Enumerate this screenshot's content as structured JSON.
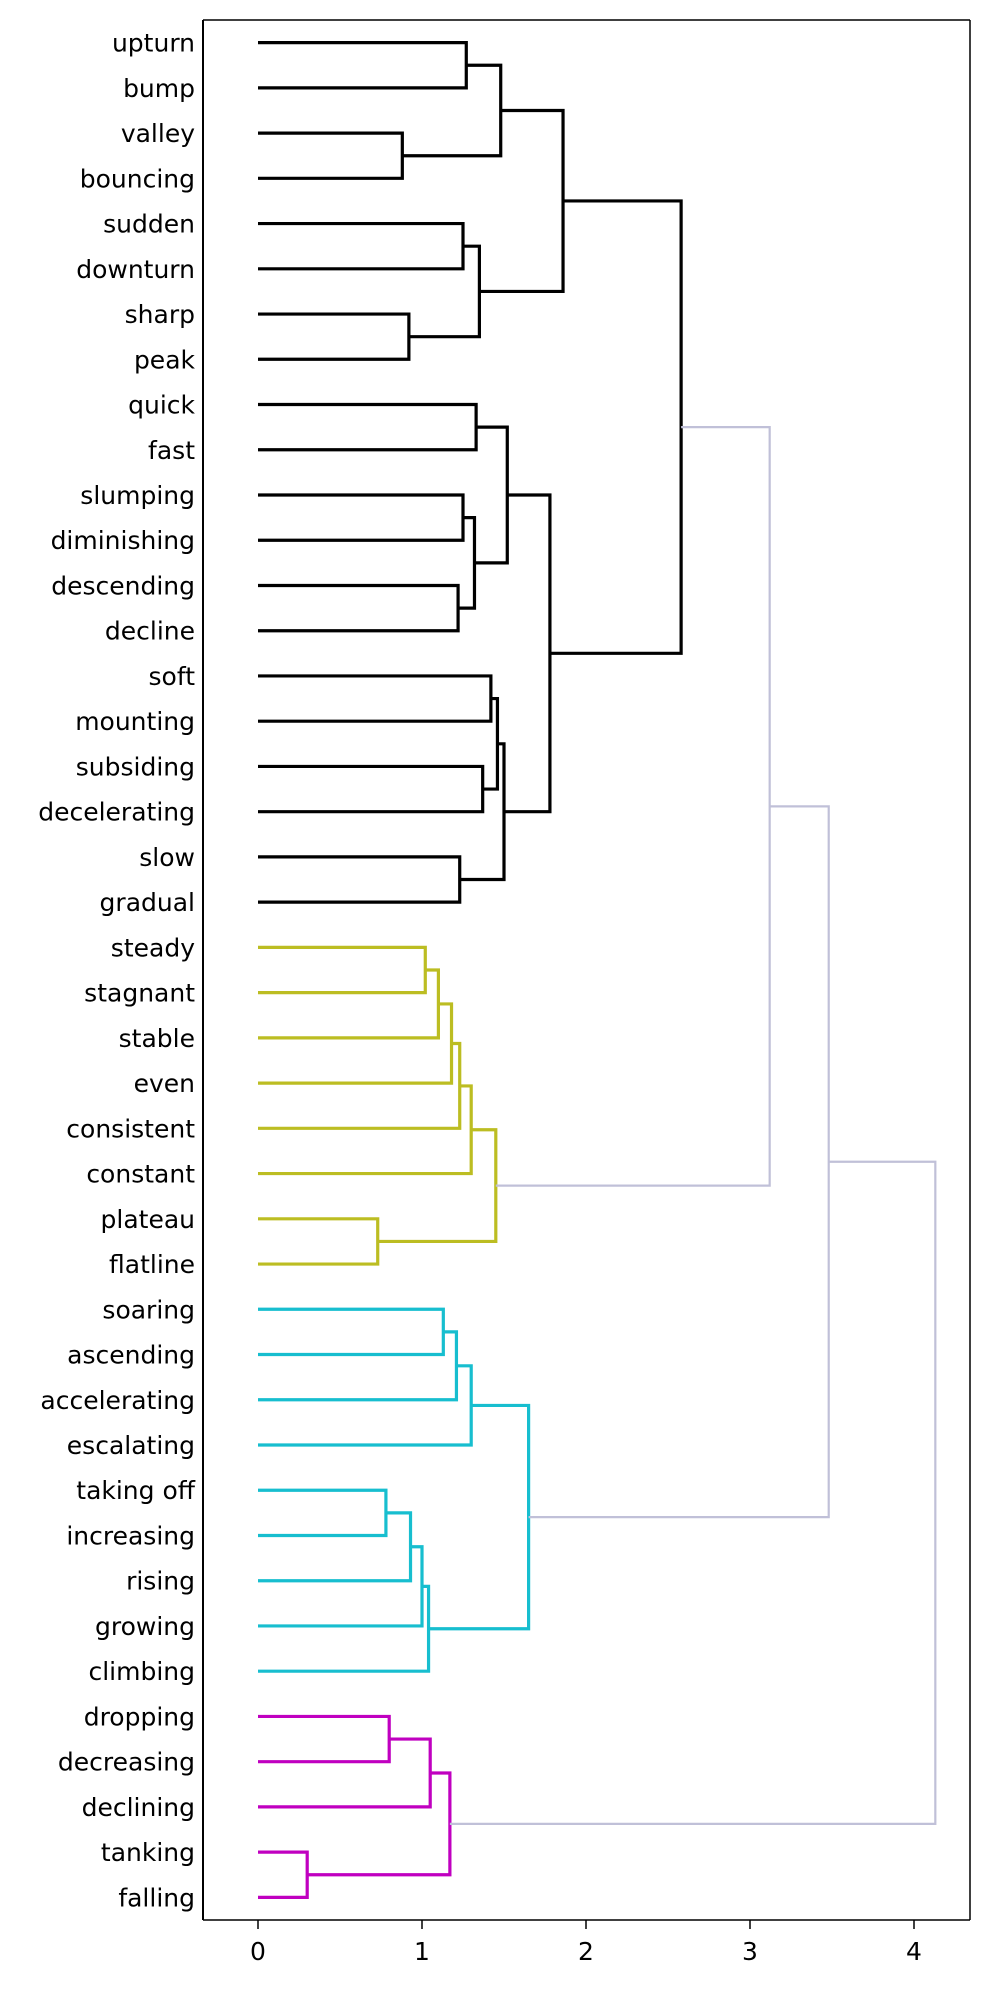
{
  "chart_data": {
    "type": "dendrogram",
    "title": "",
    "xlabel": "",
    "ylabel": "",
    "orientation": "left",
    "xlim": [
      -0.335,
      4.36
    ],
    "xticks": [
      0,
      1,
      2,
      3,
      4
    ],
    "xtick_labels": [
      "0",
      "1",
      "2",
      "3",
      "4"
    ],
    "grid": false,
    "legend": null,
    "leaf_labels": [
      "upturn",
      "bump",
      "valley",
      "bouncing",
      "sudden",
      "downturn",
      "sharp",
      "peak",
      "quick",
      "fast",
      "slumping",
      "diminishing",
      "descending",
      "decline",
      "soft",
      "mounting",
      "subsiding",
      "decelerating",
      "slow",
      "gradual",
      "steady",
      "stagnant",
      "stable",
      "even",
      "consistent",
      "constant",
      "plateau",
      "flatline",
      "soaring",
      "ascending",
      "accelerating",
      "escalating",
      "taking off",
      "increasing",
      "rising",
      "growing",
      "climbing",
      "dropping",
      "decreasing",
      "declining",
      "tanking",
      "falling"
    ],
    "cluster_colors": {
      "black": "#000000",
      "olive": "#bcbd22",
      "cyan": "#17becf",
      "magenta": "#c000c0",
      "above_threshold": "#c0c0d8"
    },
    "leaf_cluster_color": [
      "black",
      "black",
      "black",
      "black",
      "black",
      "black",
      "black",
      "black",
      "black",
      "black",
      "black",
      "black",
      "black",
      "black",
      "black",
      "black",
      "black",
      "black",
      "black",
      "black",
      "olive",
      "olive",
      "olive",
      "olive",
      "olive",
      "olive",
      "olive",
      "olive",
      "cyan",
      "cyan",
      "cyan",
      "cyan",
      "cyan",
      "cyan",
      "cyan",
      "cyan",
      "cyan",
      "magenta",
      "magenta",
      "magenta",
      "magenta"
    ],
    "links": [
      {
        "id": "L1",
        "left": {
          "type": "leaf",
          "i": 0
        },
        "right": {
          "type": "leaf",
          "i": 1
        },
        "height": 1.27,
        "color": "black"
      },
      {
        "id": "L2",
        "left": {
          "type": "leaf",
          "i": 2
        },
        "right": {
          "type": "leaf",
          "i": 3
        },
        "height": 0.88,
        "color": "black"
      },
      {
        "id": "L3",
        "left": {
          "type": "link",
          "i": "L1"
        },
        "right": {
          "type": "link",
          "i": "L2"
        },
        "height": 1.48,
        "color": "black"
      },
      {
        "id": "L4",
        "left": {
          "type": "leaf",
          "i": 4
        },
        "right": {
          "type": "leaf",
          "i": 5
        },
        "height": 1.25,
        "color": "black"
      },
      {
        "id": "L5",
        "left": {
          "type": "leaf",
          "i": 6
        },
        "right": {
          "type": "leaf",
          "i": 7
        },
        "height": 0.92,
        "color": "black"
      },
      {
        "id": "L6",
        "left": {
          "type": "link",
          "i": "L4"
        },
        "right": {
          "type": "link",
          "i": "L5"
        },
        "height": 1.35,
        "color": "black"
      },
      {
        "id": "L7",
        "left": {
          "type": "link",
          "i": "L3"
        },
        "right": {
          "type": "link",
          "i": "L6"
        },
        "height": 1.86,
        "color": "black"
      },
      {
        "id": "L8",
        "left": {
          "type": "leaf",
          "i": 8
        },
        "right": {
          "type": "leaf",
          "i": 9
        },
        "height": 1.33,
        "color": "black"
      },
      {
        "id": "L9",
        "left": {
          "type": "leaf",
          "i": 10
        },
        "right": {
          "type": "leaf",
          "i": 11
        },
        "height": 1.25,
        "color": "black"
      },
      {
        "id": "L10",
        "left": {
          "type": "leaf",
          "i": 12
        },
        "right": {
          "type": "leaf",
          "i": 13
        },
        "height": 1.22,
        "color": "black"
      },
      {
        "id": "L11",
        "left": {
          "type": "link",
          "i": "L9"
        },
        "right": {
          "type": "link",
          "i": "L10"
        },
        "height": 1.32,
        "color": "black"
      },
      {
        "id": "L12",
        "left": {
          "type": "link",
          "i": "L8"
        },
        "right": {
          "type": "link",
          "i": "L11"
        },
        "height": 1.52,
        "color": "black"
      },
      {
        "id": "L13",
        "left": {
          "type": "leaf",
          "i": 14
        },
        "right": {
          "type": "leaf",
          "i": 15
        },
        "height": 1.42,
        "color": "black"
      },
      {
        "id": "L14",
        "left": {
          "type": "leaf",
          "i": 16
        },
        "right": {
          "type": "leaf",
          "i": 17
        },
        "height": 1.37,
        "color": "black"
      },
      {
        "id": "L15",
        "left": {
          "type": "link",
          "i": "L13"
        },
        "right": {
          "type": "link",
          "i": "L14"
        },
        "height": 1.46,
        "color": "black"
      },
      {
        "id": "L16",
        "left": {
          "type": "leaf",
          "i": 18
        },
        "right": {
          "type": "leaf",
          "i": 19
        },
        "height": 1.23,
        "color": "black"
      },
      {
        "id": "L17",
        "left": {
          "type": "link",
          "i": "L15"
        },
        "right": {
          "type": "link",
          "i": "L16"
        },
        "height": 1.5,
        "color": "black"
      },
      {
        "id": "L18",
        "left": {
          "type": "link",
          "i": "L12"
        },
        "right": {
          "type": "link",
          "i": "L17"
        },
        "height": 1.78,
        "color": "black"
      },
      {
        "id": "L19",
        "left": {
          "type": "link",
          "i": "L7"
        },
        "right": {
          "type": "link",
          "i": "L18"
        },
        "height": 2.58,
        "color": "black"
      },
      {
        "id": "L20",
        "left": {
          "type": "leaf",
          "i": 20
        },
        "right": {
          "type": "leaf",
          "i": 21
        },
        "height": 1.02,
        "color": "olive"
      },
      {
        "id": "L21",
        "left": {
          "type": "link",
          "i": "L20"
        },
        "right": {
          "type": "leaf",
          "i": 22
        },
        "height": 1.1,
        "color": "olive"
      },
      {
        "id": "L22",
        "left": {
          "type": "link",
          "i": "L21"
        },
        "right": {
          "type": "leaf",
          "i": 23
        },
        "height": 1.18,
        "color": "olive"
      },
      {
        "id": "L23",
        "left": {
          "type": "link",
          "i": "L22"
        },
        "right": {
          "type": "leaf",
          "i": 24
        },
        "height": 1.23,
        "color": "olive"
      },
      {
        "id": "L24",
        "left": {
          "type": "link",
          "i": "L23"
        },
        "right": {
          "type": "leaf",
          "i": 25
        },
        "height": 1.3,
        "color": "olive"
      },
      {
        "id": "L25",
        "left": {
          "type": "leaf",
          "i": 26
        },
        "right": {
          "type": "leaf",
          "i": 27
        },
        "height": 0.73,
        "color": "olive"
      },
      {
        "id": "L26",
        "left": {
          "type": "link",
          "i": "L24"
        },
        "right": {
          "type": "link",
          "i": "L25"
        },
        "height": 1.45,
        "color": "olive"
      },
      {
        "id": "L27",
        "left": {
          "type": "leaf",
          "i": 28
        },
        "right": {
          "type": "leaf",
          "i": 29
        },
        "height": 1.13,
        "color": "cyan"
      },
      {
        "id": "L28",
        "left": {
          "type": "link",
          "i": "L27"
        },
        "right": {
          "type": "leaf",
          "i": 30
        },
        "height": 1.21,
        "color": "cyan"
      },
      {
        "id": "L29",
        "left": {
          "type": "link",
          "i": "L28"
        },
        "right": {
          "type": "leaf",
          "i": 31
        },
        "height": 1.3,
        "color": "cyan"
      },
      {
        "id": "L30",
        "left": {
          "type": "leaf",
          "i": 32
        },
        "right": {
          "type": "leaf",
          "i": 33
        },
        "height": 0.78,
        "color": "cyan"
      },
      {
        "id": "L31",
        "left": {
          "type": "link",
          "i": "L30"
        },
        "right": {
          "type": "leaf",
          "i": 34
        },
        "height": 0.93,
        "color": "cyan"
      },
      {
        "id": "L32",
        "left": {
          "type": "link",
          "i": "L31"
        },
        "right": {
          "type": "leaf",
          "i": 35
        },
        "height": 1.0,
        "color": "cyan"
      },
      {
        "id": "L33",
        "left": {
          "type": "link",
          "i": "L32"
        },
        "right": {
          "type": "leaf",
          "i": 36
        },
        "height": 1.04,
        "color": "cyan"
      },
      {
        "id": "L34",
        "left": {
          "type": "link",
          "i": "L29"
        },
        "right": {
          "type": "link",
          "i": "L33"
        },
        "height": 1.65,
        "color": "cyan"
      },
      {
        "id": "L35",
        "left": {
          "type": "leaf",
          "i": 37
        },
        "right": {
          "type": "leaf",
          "i": 38
        },
        "height": 0.8,
        "color": "magenta"
      },
      {
        "id": "L36",
        "left": {
          "type": "link",
          "i": "L35"
        },
        "right": {
          "type": "leaf",
          "i": 39
        },
        "height": 1.05,
        "color": "magenta"
      },
      {
        "id": "L37",
        "left": {
          "type": "leaf",
          "i": 40
        },
        "right": {
          "type": "leaf",
          "i": 41
        },
        "height": 0.3,
        "color": "magenta"
      },
      {
        "id": "L38",
        "left": {
          "type": "link",
          "i": "L36"
        },
        "right": {
          "type": "link",
          "i": "L37"
        },
        "height": 1.17,
        "color": "magenta"
      },
      {
        "id": "L39",
        "left": {
          "type": "link",
          "i": "L19"
        },
        "right": {
          "type": "link",
          "i": "L26"
        },
        "height": 3.12,
        "color": "above_threshold"
      },
      {
        "id": "L40",
        "left": {
          "type": "link",
          "i": "L39"
        },
        "right": {
          "type": "link",
          "i": "L34"
        },
        "height": 3.48,
        "color": "above_threshold"
      },
      {
        "id": "L41",
        "left": {
          "type": "link",
          "i": "L40"
        },
        "right": {
          "type": "link",
          "i": "L38"
        },
        "height": 4.13,
        "color": "above_threshold"
      }
    ]
  },
  "axis": {
    "tick_labels": [
      "0",
      "1",
      "2",
      "3",
      "4"
    ]
  }
}
